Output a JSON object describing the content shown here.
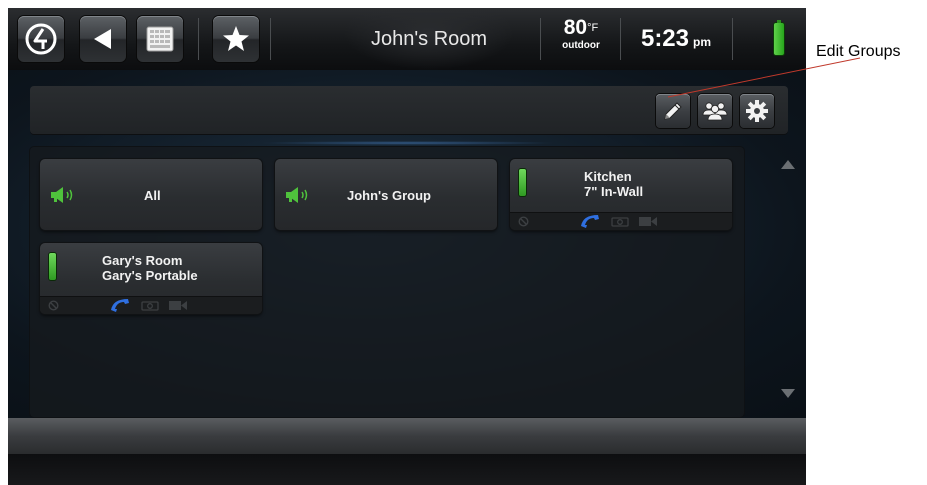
{
  "status_bar": {
    "room_title": "John's Room",
    "temperature": "80",
    "temperature_unit": "°F",
    "temperature_label": "outdoor",
    "time": "5:23",
    "time_suffix": "pm"
  },
  "groups": [
    {
      "label": "All"
    },
    {
      "label": "John's Group"
    }
  ],
  "devices": [
    {
      "room": "Kitchen",
      "device": "7\" In-Wall"
    },
    {
      "room": "Gary's Room",
      "device": "Gary's Portable"
    }
  ],
  "annotation": {
    "label": "Edit Groups"
  },
  "icons": {
    "logo": "logo-icon",
    "back": "back-arrow-icon",
    "keypad": "keypad-icon",
    "favorites": "star-icon",
    "battery": "battery-icon",
    "edit": "pencil-icon",
    "groups": "people-group-icon",
    "settings": "gear-icon",
    "speaker": "speaker-icon",
    "dnd": "do-not-disturb-icon",
    "phone": "phone-icon",
    "camera": "camera-icon",
    "video": "video-icon",
    "scroll_up": "scroll-up-icon",
    "scroll_down": "scroll-down-icon"
  },
  "colors": {
    "accent_green": "#4fc23c",
    "phone_blue": "#2f6fe0",
    "background": "#0b0e12"
  }
}
